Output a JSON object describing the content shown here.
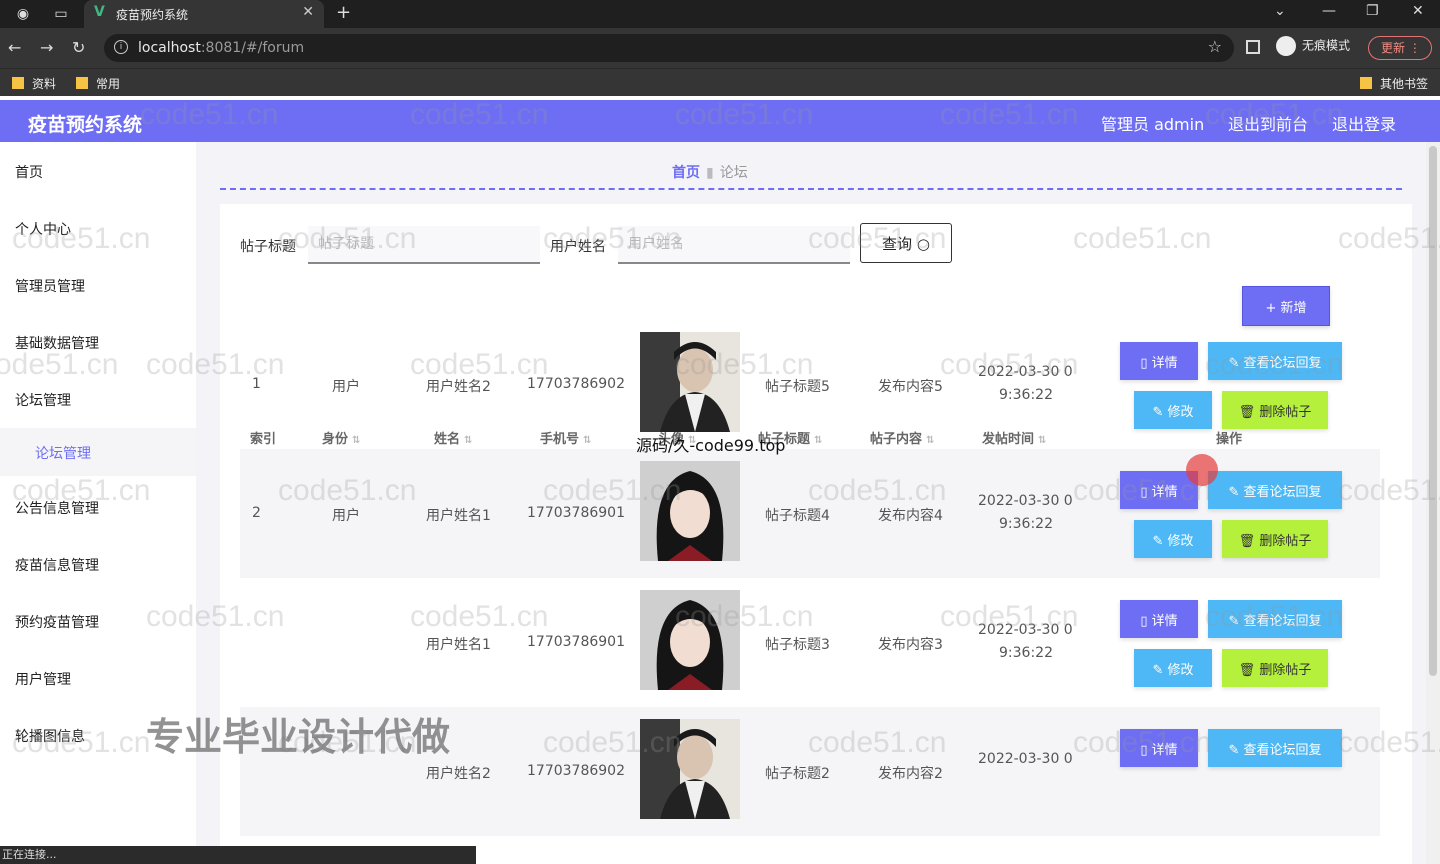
{
  "browser": {
    "tab_title": "疫苗预约系统",
    "url_host": "localhost",
    "url_rest": ":8081/#/forum",
    "incognito_label": "无痕模式",
    "update_label": "更新",
    "bookmarks": [
      "资料",
      "常用"
    ],
    "other_bookmarks": "其他书签",
    "status": "正在连接..."
  },
  "header": {
    "brand": "疫苗预约系统",
    "admin": "管理员 admin",
    "to_front": "退出到前台",
    "logout": "退出登录"
  },
  "sidebar": {
    "items": [
      "首页",
      "个人中心",
      "管理员管理",
      "基础数据管理",
      "论坛管理",
      "公告信息管理",
      "疫苗信息管理",
      "预约疫苗管理",
      "用户管理",
      "轮播图信息"
    ],
    "sub_active": "论坛管理"
  },
  "breadcrumb": {
    "home": "首页",
    "current": "论坛"
  },
  "search": {
    "title_label": "帖子标题",
    "title_placeholder": "帖子标题",
    "name_label": "用户姓名",
    "name_placeholder": "用户姓名",
    "button": "查询"
  },
  "add_button": "+ 新增",
  "table": {
    "headers": {
      "index": "索引",
      "role": "身份",
      "name": "姓名",
      "phone": "手机号",
      "avatar": "头像",
      "title": "帖子标题",
      "content": "帖子内容",
      "time": "发帖时间",
      "actions": "操作"
    },
    "actions": {
      "detail": "详情",
      "reply": "查看论坛回复",
      "edit": "修改",
      "delete": "删除帖子"
    },
    "rows": [
      {
        "index": "1",
        "role": "用户",
        "name": "用户姓名2",
        "phone": "17703786902",
        "title": "帖子标题5",
        "content": "发布内容5",
        "time1": "2022-03-30 0",
        "time2": "9:36:22",
        "avatar": "male"
      },
      {
        "index": "2",
        "role": "用户",
        "name": "用户姓名1",
        "phone": "17703786901",
        "title": "帖子标题4",
        "content": "发布内容4",
        "time1": "2022-03-30 0",
        "time2": "9:36:22",
        "avatar": "female"
      },
      {
        "index": "",
        "role": "",
        "name": "用户姓名1",
        "phone": "17703786901",
        "title": "帖子标题3",
        "content": "发布内容3",
        "time1": "2022-03-30 0",
        "time2": "9:36:22",
        "avatar": "female"
      },
      {
        "index": "",
        "role": "",
        "name": "用户姓名2",
        "phone": "17703786902",
        "title": "帖子标题2",
        "content": "发布内容2",
        "time1": "2022-03-30 0",
        "time2": "",
        "avatar": "male"
      }
    ]
  },
  "overlays": {
    "watermark": "code51.cn",
    "promo": "专业毕业设计代做",
    "source": "源码/久-code99.top"
  },
  "colors": {
    "primary": "#6e6ef5",
    "info": "#4db8f5",
    "danger_lime": "#b4f03c"
  }
}
